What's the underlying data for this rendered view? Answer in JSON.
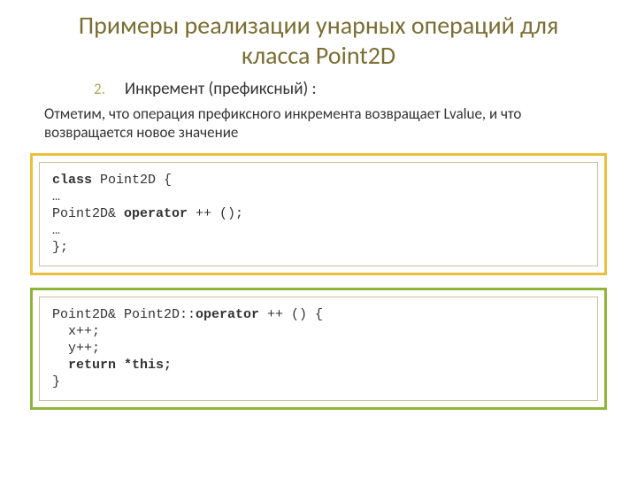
{
  "title": "Примеры реализации унарных операций для класса Point2D",
  "list": {
    "num": "2.",
    "text": "Инкремент  (префиксный) :"
  },
  "para": "   Отметим, что операция префиксного инкремента возвращает Lvalue, и что возвращается новое значение",
  "code1": {
    "l1a": "class",
    "l1b": " Point2D {",
    "l2": "…",
    "l3a": "Point2D& ",
    "l3b": "operator",
    "l3c": " ++ ();",
    "l4": "…",
    "l5": "};"
  },
  "code2": {
    "l1a": "Point2D& Point2D::",
    "l1b": "operator",
    "l1c": " ++ () {",
    "l2": "  x++;",
    "l3": "  y++;",
    "l4a": "  ",
    "l4b": "return *this;",
    "l5": "}"
  }
}
